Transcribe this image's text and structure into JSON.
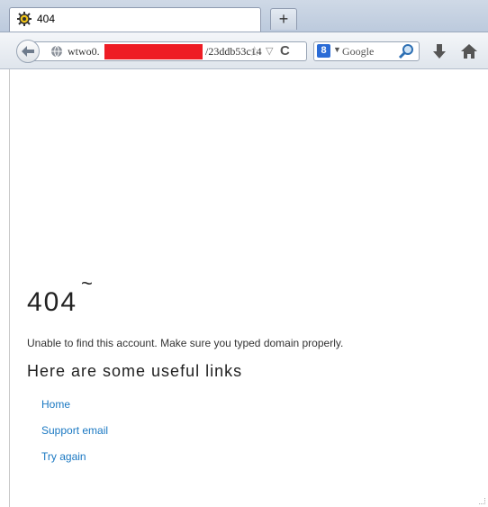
{
  "tab": {
    "title": "404",
    "new_tab_symbol": "+"
  },
  "navbar": {
    "url_prefix": "wtwo0.",
    "url_suffix": "/23ddb53c14",
    "search_placeholder": "Google",
    "search_engine_letter": "8"
  },
  "icons": {
    "tab_favicon": "gear-favicon-icon",
    "back": "back-arrow-icon",
    "globe": "globe-icon",
    "star": "star-icon",
    "reload": "reload-icon",
    "search": "magnifier-icon",
    "download": "download-arrow-icon",
    "home": "home-icon"
  },
  "colors": {
    "link": "#1a78c2",
    "redaction": "#ee1c24"
  },
  "page": {
    "error_code": "404",
    "error_tilde": "~",
    "message": "Unable to find this account. Make sure you typed domain properly.",
    "links_heading": "Here are some useful links",
    "links": [
      {
        "label": "Home"
      },
      {
        "label": "Support email"
      },
      {
        "label": "Try again"
      }
    ]
  }
}
